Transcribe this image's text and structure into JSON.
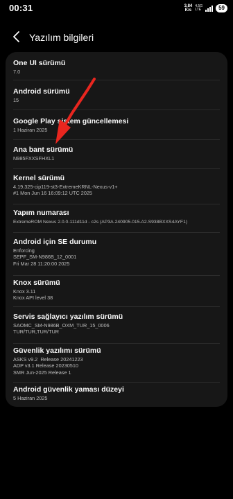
{
  "status_bar": {
    "time": "00:31",
    "net_speed_value": "3,84",
    "net_speed_unit": "K/s",
    "carrier_top": "4.5G",
    "carrier_bottom": "LTE",
    "battery": "59"
  },
  "header": {
    "title": "Yazılım bilgileri"
  },
  "items": [
    {
      "title": "One UI sürümü",
      "value": "7.0"
    },
    {
      "title": "Android sürümü",
      "value": "15"
    },
    {
      "title": "Google Play sistem güncellemesi",
      "value": "1 Haziran 2025"
    },
    {
      "title": "Ana bant sürümü",
      "value": "N985FXXSFHXL1"
    },
    {
      "title": "Kernel sürümü",
      "value": "4.19.325-cip119-st3-ExtremeKRNL-Nexus-v1+\n#1 Mon Jun 16 16:09:12 UTC 2025"
    },
    {
      "title": "Yapım numarası",
      "value": "ExtremeROM Nexus 2.0.0-111d11d - c2s (AP3A.240905.015.A2.S938BXXS4AYF1)"
    },
    {
      "title": "Android için SE durumu",
      "value": "Enforcing\nSEPF_SM-N986B_12_0001\nFri Mar 28 11:20:00 2025"
    },
    {
      "title": "Knox sürümü",
      "value": "Knox 3.11\nKnox API level 38"
    },
    {
      "title": "Servis sağlayıcı yazılım sürümü",
      "value": "SAOMC_SM-N986B_OXM_TUR_15_0006\nTUR/TUR,TUR/TUR"
    },
    {
      "title": "Güvenlik yazılımı sürümü",
      "value": "ASKS v9.2  Release 20241223\nADP v3.1 Release 20230510\nSMR Jun-2025 Release 1"
    },
    {
      "title": "Android güvenlik yaması düzeyi",
      "value": "5 Haziran 2025"
    }
  ],
  "colors": {
    "background": "#000000",
    "card": "#171717",
    "annotation_arrow": "#e8261f"
  }
}
